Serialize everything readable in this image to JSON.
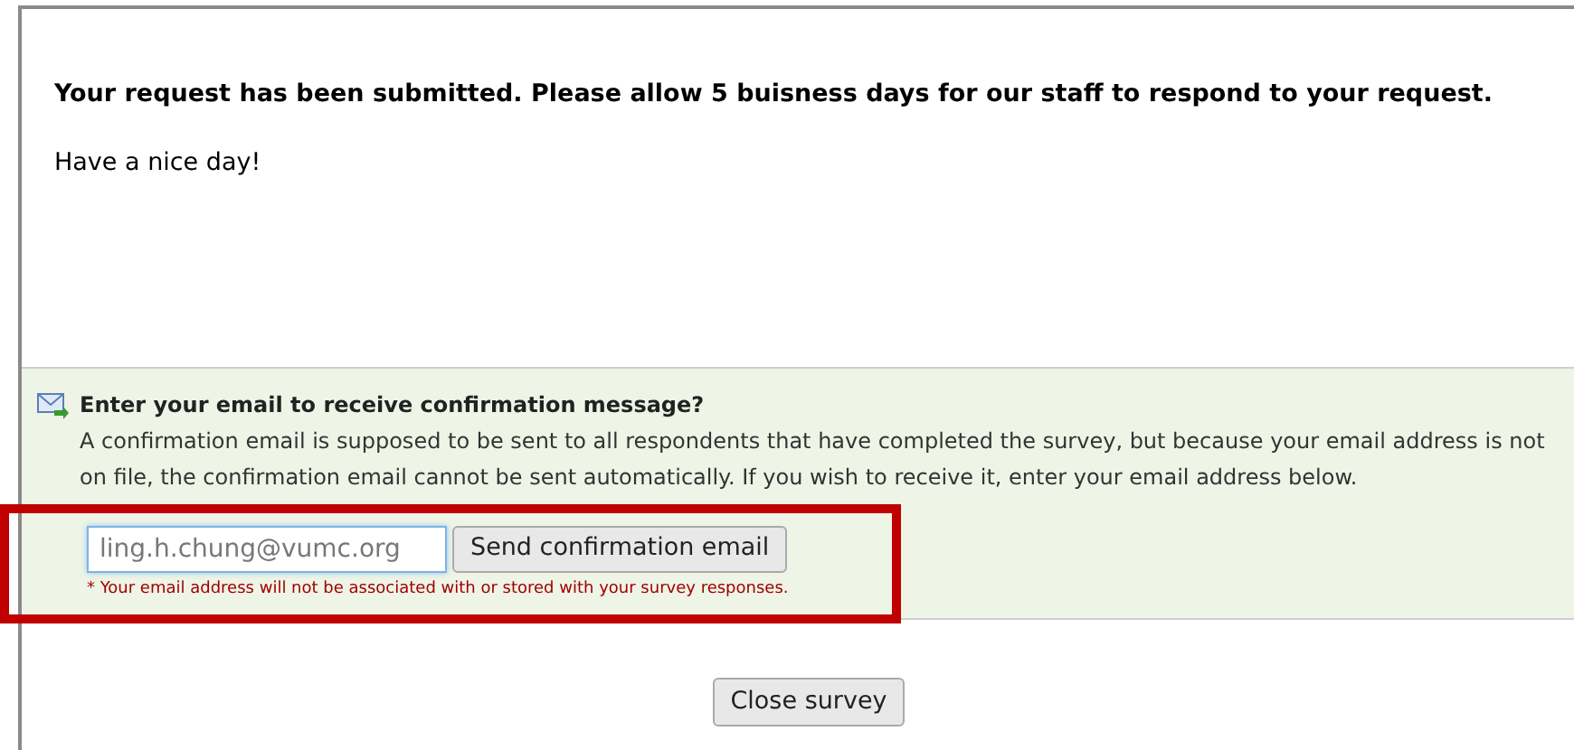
{
  "message": "Your request has been submitted. Please allow 5 buisness days for our staff to respond to your request.",
  "greeting": "Have a nice day!",
  "confirmation": {
    "title": "Enter your email to receive confirmation message?",
    "text": "A confirmation email is supposed to be sent to all respondents that have completed the survey, but because your email address is not on file, the confirmation email cannot be sent automatically. If you wish to receive it, enter your email address below.",
    "email_field": {
      "value": "ling.h.chung@vumc.org",
      "focused": true
    },
    "send_button": "Send confirmation email",
    "note": "* Your email address will not be associated with or stored with your survey responses."
  },
  "close_button": "Close survey"
}
